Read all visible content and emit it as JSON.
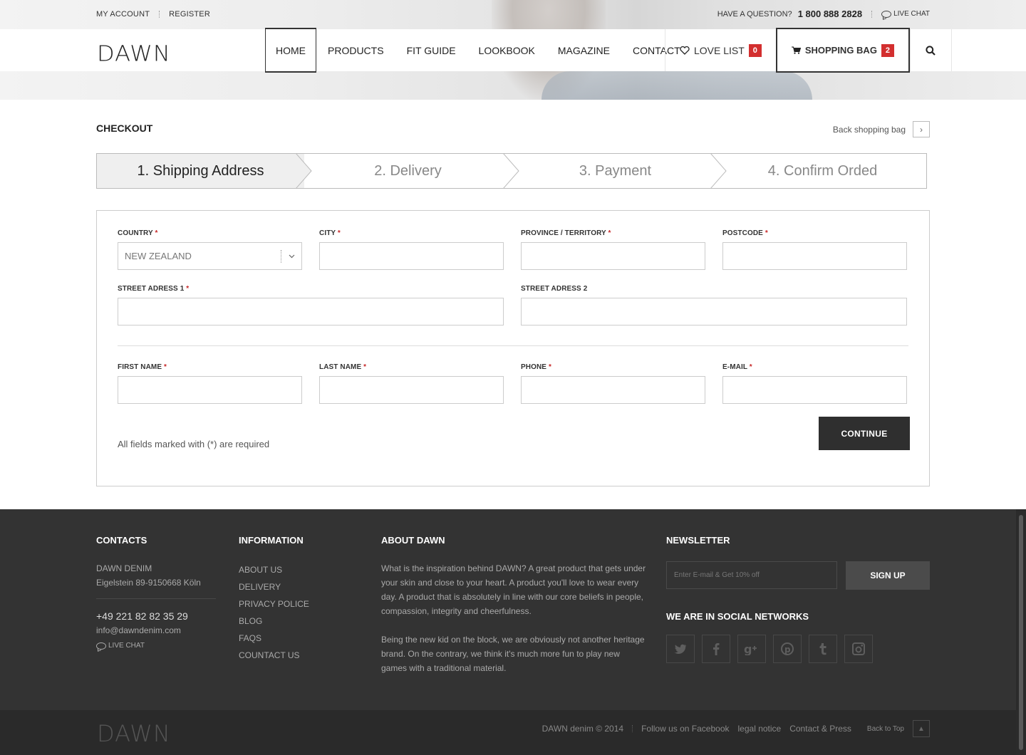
{
  "topbar": {
    "my_account": "MY ACCOUNT",
    "register": "REGISTER",
    "question": "HAVE A QUESTION?",
    "phone": "1 800 888 2828",
    "live_chat": "LIVE CHAT"
  },
  "brand": {
    "logo": "DAWN"
  },
  "nav": {
    "items": [
      "HOME",
      "PRODUCTS",
      "FIT GUIDE",
      "LOOKBOOK",
      "MAGAZINE",
      "CONTACT"
    ],
    "love_list": "LOVE LIST",
    "love_count": "0",
    "shopping_bag": "SHOPPING BAG",
    "bag_count": "2"
  },
  "checkout": {
    "title": "CHECKOUT",
    "back_label": "Back shopping bag",
    "steps": [
      "1. Shipping Address",
      "2. Delivery",
      "3. Payment",
      "4. Confirm Orded"
    ],
    "active_step": 0
  },
  "form": {
    "country_label": "COUNTRY",
    "country_value": "NEW ZEALAND",
    "city_label": "CITY",
    "province_label": "PROVINCE / TERRITORY",
    "postcode_label": "POSTCODE",
    "street1_label": "STREET ADRESS 1",
    "street2_label": "STREET ADRESS 2",
    "firstname_label": "FIRST NAME",
    "lastname_label": "LAST NAME",
    "phone_label": "PHONE",
    "email_label": "E-MAIL",
    "required_mark": "*",
    "required_note": "All fields marked with (*) are required",
    "continue_label": "CONTINUE"
  },
  "footer": {
    "contacts": {
      "title": "CONTACTS",
      "company": "DAWN DENIM",
      "address": "Eigelstein 89-9150668 Köln",
      "phone": "+49 221 82 82 35 29",
      "email": "info@dawndenim.com",
      "live_chat": "LIVE CHAT"
    },
    "information": {
      "title": "INFORMATION",
      "links": [
        "ABOUT US",
        "DELIVERY",
        "PRIVACY POLICE",
        "BLOG",
        "FAQS",
        "COUNTACT US"
      ]
    },
    "about": {
      "title": "ABOUT DAWN",
      "p1": "What is the inspiration behind DAWN? A great product that gets under your skin and close to your heart. A product you'll love to wear every day. A product that is absolutely in line with our core beliefs in people, compassion, integrity and cheerfulness.",
      "p2": "Being the new kid on the block, we are obviously not another heritage brand. On the contrary, we think it's much more fun to play new games with a traditional material."
    },
    "newsletter": {
      "title": "NEWSLETTER",
      "placeholder": "Enter E-mail & Get 10% off",
      "button": "SIGN UP",
      "social_title": "WE ARE IN SOCIAL NETWORKS",
      "socials": [
        "twitter-icon",
        "facebook-icon",
        "google-plus-icon",
        "pinterest-icon",
        "tumblr-icon",
        "instagram-icon"
      ]
    },
    "bottom": {
      "logo": "DAWN",
      "copyright": "DAWN denim © 2014",
      "facebook": "Follow us on Facebook",
      "legal": "legal notice",
      "contact_press": "Contact & Press",
      "back_to_top": "Back to Top"
    }
  },
  "colors": {
    "accent_red": "#d32f2f",
    "dark": "#2f2f2f",
    "footer_bg": "#333333"
  }
}
